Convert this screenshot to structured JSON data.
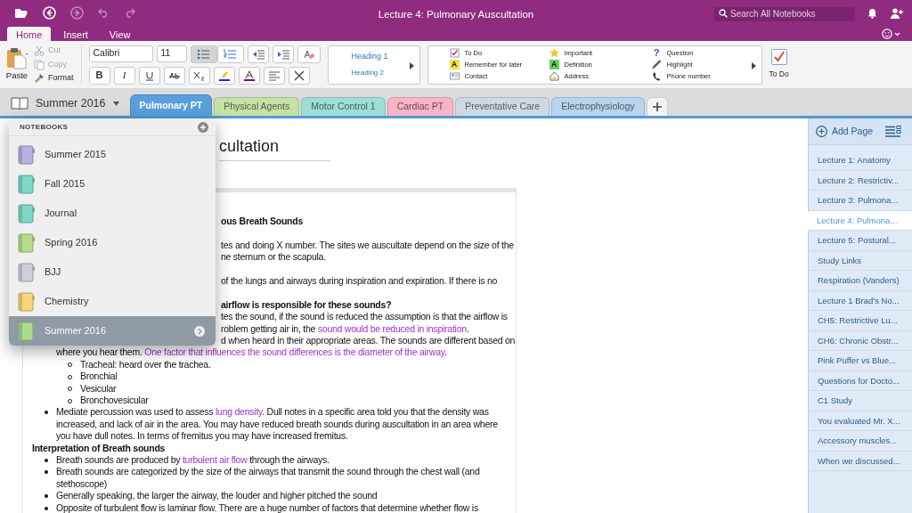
{
  "title_bar": {
    "title": "Lecture 4: Pulmonary Auscultation",
    "search": {
      "placeholder": "Search All Notebooks"
    },
    "toolbar": [
      {
        "disabled": false
      },
      {
        "disabled": false
      },
      {
        "disabled": true
      },
      {
        "disabled": true
      },
      {
        "disabled": true
      }
    ]
  },
  "ribbon_tabs": [
    {
      "label": "Home",
      "selected": true
    },
    {
      "label": "Insert",
      "selected": false
    },
    {
      "label": "View",
      "selected": false
    }
  ],
  "clipboard": {
    "paste": "Paste",
    "cut": {
      "label": "Cut",
      "disabled": true
    },
    "copy": {
      "label": "Copy",
      "disabled": true
    },
    "format": "Format"
  },
  "font": {
    "name": "Calibri",
    "size": "11"
  },
  "format_buttons": [
    "B",
    "I"
  ],
  "list_buttons": [
    {
      "selected": true
    },
    {
      "selected": false
    }
  ],
  "styles": [
    "Heading 1",
    "Heading 2"
  ],
  "tags": [
    {
      "label": "To Do"
    },
    {
      "label": "Remember for later",
      "glyph": "A"
    },
    {
      "label": "Contact"
    },
    {
      "label": "Important"
    },
    {
      "label": "Definition",
      "glyph": "A"
    },
    {
      "label": "Address"
    },
    {
      "label": "Question",
      "glyph": "?"
    },
    {
      "label": "Highlight"
    },
    {
      "label": "Phone number"
    }
  ],
  "todo_button": "To Do",
  "notebook": {
    "name": "Summer 2016"
  },
  "sections": [
    {
      "label": "Pulmonary PT",
      "color": "#5a9fdc",
      "selected": true
    },
    {
      "label": "Physical Agents",
      "color": "#c4e2a4",
      "selected": false
    },
    {
      "label": "Motor Control 1",
      "color": "#9edfd2",
      "selected": false
    },
    {
      "label": "Cardiac PT",
      "color": "#f8b5c3",
      "selected": false
    },
    {
      "label": "Preventative Care",
      "color": "#cfd9e2",
      "selected": false
    },
    {
      "label": "Electrophysiology",
      "color": "#b7d5ef",
      "selected": false
    }
  ],
  "notebooks_menu": {
    "title": "NOTEBOOKS",
    "items": [
      {
        "name": "Summer 2015",
        "color": "#b9b1e2",
        "selected": false
      },
      {
        "name": "Fall 2015",
        "color": "#7fd8c7",
        "selected": false
      },
      {
        "name": "Journal",
        "color": "#7fd8c7",
        "selected": false
      },
      {
        "name": "Spring 2016",
        "color": "#b7dc8c",
        "selected": false
      },
      {
        "name": "BJJ",
        "color": "#cbd0d7",
        "selected": false
      },
      {
        "name": "Chemistry",
        "color": "#f5d67c",
        "selected": false
      },
      {
        "name": "Summer 2016",
        "color": "#a9dc8f",
        "selected": true
      }
    ]
  },
  "page": {
    "title": "cultation",
    "lines": [
      {
        "kind": "fragment",
        "bold": true,
        "blank_before": false,
        "parts": [
          {
            "text": "ous Breath Sounds",
            "highlight": false
          }
        ]
      },
      {
        "kind": "fragment",
        "bold": false,
        "blank_before": true,
        "parts": [
          {
            "text": "tes and doing X number. The sites we auscultate depend on the size of the",
            "highlight": false
          }
        ]
      },
      {
        "kind": "fragment",
        "bold": false,
        "blank_before": false,
        "parts": [
          {
            "text": "ne sternum or the scapula.",
            "highlight": false
          }
        ]
      },
      {
        "kind": "fragment",
        "bold": false,
        "blank_before": true,
        "parts": [
          {
            "text": "of the lungs and airways during inspiration and expiration.  If there is no",
            "highlight": false
          }
        ]
      },
      {
        "kind": "fragment",
        "bold": true,
        "blank_before": true,
        "parts": [
          {
            "text": "airflow is responsible for these sounds?",
            "highlight": false
          }
        ]
      },
      {
        "kind": "fragment",
        "bold": false,
        "blank_before": false,
        "parts": [
          {
            "text": "tes the sound, if the sound is reduced the assumption is that the airflow is",
            "highlight": false
          }
        ]
      },
      {
        "kind": "fragment",
        "bold": false,
        "blank_before": false,
        "parts": [
          {
            "text": "roblem getting air in, the ",
            "highlight": false
          },
          {
            "text": "sound would be reduced in inspiration",
            "highlight": true
          },
          {
            "text": ".",
            "highlight": false
          }
        ]
      },
      {
        "kind": "fragment",
        "bold": false,
        "blank_before": false,
        "parts": [
          {
            "text": "d when heard in their appropriate areas. The sounds are different based on",
            "highlight": false
          }
        ]
      },
      {
        "kind": "cont",
        "bold": false,
        "blank_before": false,
        "parts": [
          {
            "text": "where you hear them. ",
            "highlight": false
          },
          {
            "text": "One factor that influences the sound differences is the diameter of the airway",
            "highlight": true
          },
          {
            "text": ".",
            "highlight": false
          }
        ]
      },
      {
        "kind": "sub",
        "bold": false,
        "blank_before": false,
        "parts": [
          {
            "text": "Tracheal: heard over the trachea.",
            "highlight": false
          }
        ]
      },
      {
        "kind": "sub",
        "bold": false,
        "blank_before": false,
        "parts": [
          {
            "text": "Bronchial",
            "highlight": false
          }
        ]
      },
      {
        "kind": "sub",
        "bold": false,
        "blank_before": false,
        "parts": [
          {
            "text": "Vesicular",
            "highlight": false
          }
        ]
      },
      {
        "kind": "sub",
        "bold": false,
        "blank_before": false,
        "parts": [
          {
            "text": "Bronchovesicular",
            "highlight": false
          }
        ]
      },
      {
        "kind": "bullet",
        "bold": false,
        "blank_before": false,
        "parts": [
          {
            "text": "Mediate percussion was used to assess ",
            "highlight": false
          },
          {
            "text": "lung density",
            "highlight": true
          },
          {
            "text": ". Dull notes in a specific area told you that the density was",
            "highlight": false
          }
        ]
      },
      {
        "kind": "cont",
        "bold": false,
        "blank_before": false,
        "parts": [
          {
            "text": "increased, and lack of air in the area. You may have reduced breath sounds during auscultation in an area where",
            "highlight": false
          }
        ]
      },
      {
        "kind": "cont",
        "bold": false,
        "blank_before": false,
        "parts": [
          {
            "text": "you have dull notes.  In terms of fremitus you may have increased fremitus.",
            "highlight": false
          }
        ]
      },
      {
        "kind": "heading",
        "bold": true,
        "blank_before": false,
        "parts": [
          {
            "text": "Interpretation of Breath sounds",
            "highlight": false
          }
        ]
      },
      {
        "kind": "bullet",
        "bold": false,
        "blank_before": false,
        "parts": [
          {
            "text": "Breath sounds are produced by ",
            "highlight": false
          },
          {
            "text": "turbulent air flow",
            "highlight": true
          },
          {
            "text": " through the airways.",
            "highlight": false
          }
        ]
      },
      {
        "kind": "bullet",
        "bold": false,
        "blank_before": false,
        "parts": [
          {
            "text": "Breath sounds are categorized by the size of the airways that transmit the sound through the chest wall (and",
            "highlight": false
          }
        ]
      },
      {
        "kind": "cont",
        "bold": false,
        "blank_before": false,
        "parts": [
          {
            "text": "stethoscope)",
            "highlight": false
          }
        ]
      },
      {
        "kind": "bullet",
        "bold": false,
        "blank_before": false,
        "parts": [
          {
            "text": "Generally speaking, the larger the airway, the louder and higher pitched the sound",
            "highlight": false
          }
        ]
      },
      {
        "kind": "bullet",
        "bold": false,
        "blank_before": false,
        "parts": [
          {
            "text": "Opposite of turbulent flow is laminar flow. There are a huge number of factors that determine whether flow is",
            "highlight": false
          }
        ]
      }
    ]
  },
  "pages": {
    "add": "Add Page",
    "items": [
      {
        "title": "Lecture 1: Anatomy",
        "selected": false
      },
      {
        "title": "Lecture 2: Restrictiv...",
        "selected": false
      },
      {
        "title": "Lecture 3: Pulmona...",
        "selected": false
      },
      {
        "title": "Lecture 4: Pulmona...",
        "selected": true
      },
      {
        "title": "Lecture 5: Postural...",
        "selected": false
      },
      {
        "title": "Study Links",
        "selected": false
      },
      {
        "title": "Respiration (Vanders)",
        "selected": false
      },
      {
        "title": "Lecture 1 Brad's No...",
        "selected": false
      },
      {
        "title": "CH5: Restrictive Lu...",
        "selected": false
      },
      {
        "title": "CH6: Chronic Obstr...",
        "selected": false
      },
      {
        "title": "Pink Puffer vs Blue...",
        "selected": false
      },
      {
        "title": "Questions for Docto...",
        "selected": false
      },
      {
        "title": "C1 Study",
        "selected": false
      },
      {
        "title": "You evaluated Mr. X...",
        "selected": false
      },
      {
        "title": "Accessory muscles...",
        "selected": false
      },
      {
        "title": "When we discussed...",
        "selected": false
      }
    ]
  }
}
